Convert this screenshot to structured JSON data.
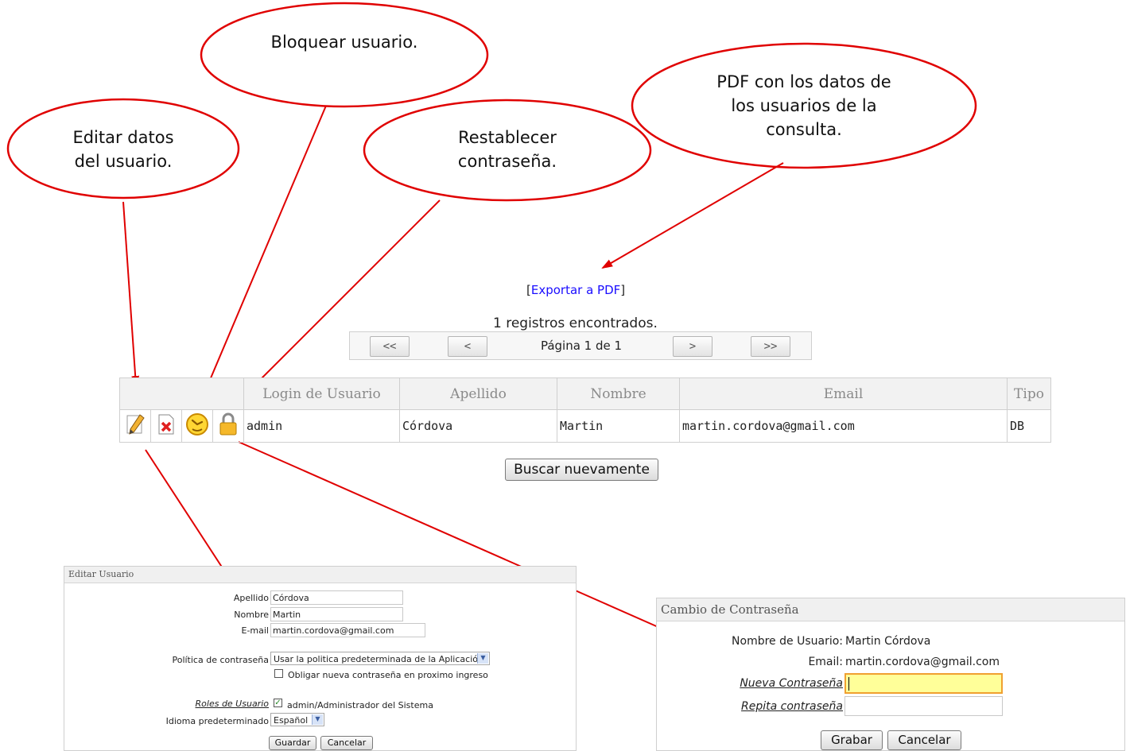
{
  "callouts": {
    "edit": "Editar datos\ndel usuario.",
    "block": "Bloquear usuario.",
    "reset": "Restablecer\ncontraseña.",
    "pdf": "PDF con los datos de\nlos usuarios de la\nconsulta."
  },
  "export": {
    "open": "[",
    "link": "Exportar a PDF",
    "close": "]"
  },
  "results": {
    "count_text": "1 registros encontrados."
  },
  "pager": {
    "first": "<<",
    "prev": "<",
    "info": "Página 1 de 1",
    "next": ">",
    "last": ">>"
  },
  "users_table": {
    "headers": [
      "Login de Usuario",
      "Apellido",
      "Nombre",
      "Email",
      "Tipo"
    ],
    "rows": [
      {
        "login": "admin",
        "apellido": "Córdova",
        "nombre": "Martin",
        "email": "martin.cordova@gmail.com",
        "tipo": "DB"
      }
    ]
  },
  "search_again": "Buscar nuevamente",
  "edit_form": {
    "title": "Editar Usuario",
    "apellido_label": "Apellido",
    "apellido_value": "Córdova",
    "nombre_label": "Nombre",
    "nombre_value": "Martin",
    "email_label": "E-mail",
    "email_value": "martin.cordova@gmail.com",
    "policy_label": "Política de contraseña",
    "policy_value": "Usar la politica predeterminada de la Aplicación",
    "force_change_label": "Obligar nueva contraseña en proximo ingreso",
    "roles_label": "Roles de Usuario",
    "role_value": "admin/Administrador del Sistema",
    "lang_label": "Idioma predeterminado",
    "lang_value": "Español",
    "save": "Guardar",
    "cancel": "Cancelar"
  },
  "password_form": {
    "title": "Cambio de Contraseña",
    "username_label": "Nombre de Usuario:",
    "username_value": "Martin Córdova",
    "email_label": "Email:",
    "email_value": "martin.cordova@gmail.com",
    "new_label": "Nueva Contraseña",
    "repeat_label": "Repita contraseña",
    "save": "Grabar",
    "cancel": "Cancelar"
  },
  "colors": {
    "callout_red": "#e00000",
    "link_blue": "#1a0dff",
    "focus_orange": "#f0a030",
    "focus_fill": "#ffff99"
  }
}
